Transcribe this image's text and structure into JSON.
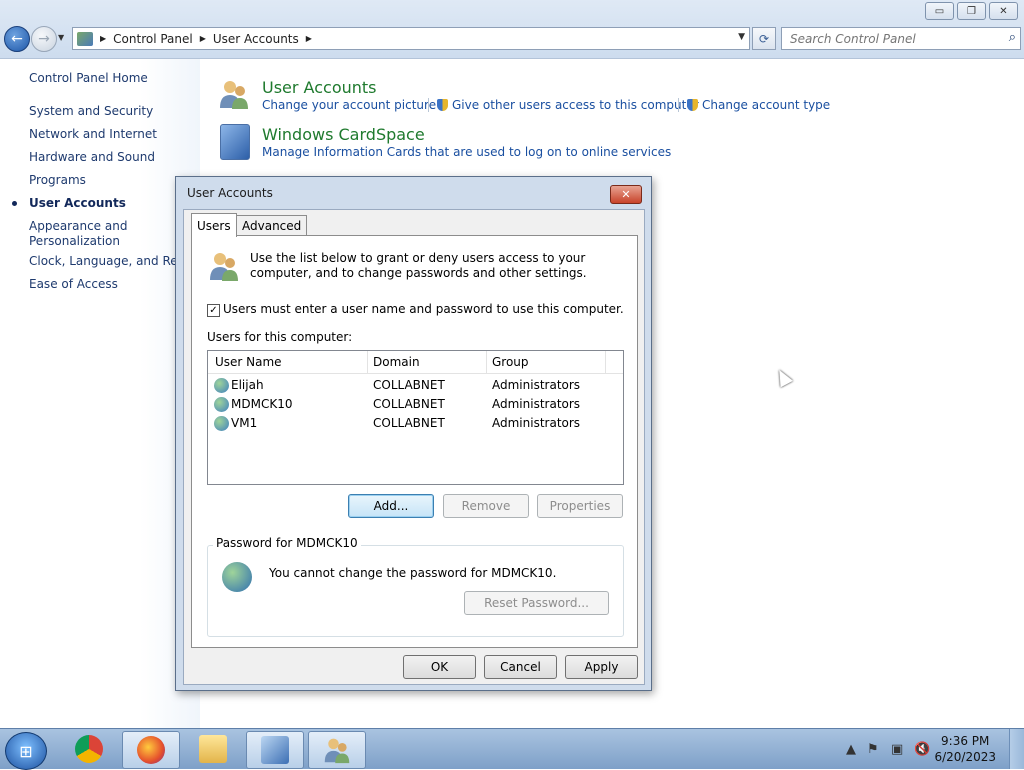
{
  "window": {
    "controls": [
      "▭",
      "❐",
      "✕"
    ]
  },
  "nav": {
    "back_icon": "←",
    "forward_icon": "→",
    "breadcrumbs": [
      "Control Panel",
      "User Accounts"
    ],
    "refresh_icon": "⟳",
    "search_placeholder": "Search Control Panel"
  },
  "sidebar": {
    "home": "Control Panel Home",
    "items": [
      {
        "label": "System and Security"
      },
      {
        "label": "Network and Internet"
      },
      {
        "label": "Hardware and Sound"
      },
      {
        "label": "Programs"
      },
      {
        "label": "User Accounts"
      },
      {
        "label": "Appearance and"
      },
      {
        "label": "Personalization"
      },
      {
        "label": "Clock, Language, and Regio"
      },
      {
        "label": "Ease of Access"
      }
    ]
  },
  "main": {
    "user_accounts": {
      "title": "User Accounts",
      "links": [
        "Change your account picture",
        "Give other users access to this computer",
        "Change account type"
      ]
    },
    "cardspace": {
      "title": "Windows CardSpace",
      "link": "Manage Information Cards that are used to log on to online services"
    }
  },
  "dialog": {
    "title": "User Accounts",
    "close_label": "✕",
    "tabs": [
      "Users",
      "Advanced"
    ],
    "intro": "Use the list below to grant or deny users access to your computer, and to change passwords and other settings.",
    "checkbox_label": "Users must enter a user name and password to use this computer.",
    "checkbox_checked": true,
    "checkbox_mark": "✓",
    "users_label": "Users for this computer:",
    "columns": [
      "User Name",
      "Domain",
      "Group"
    ],
    "rows": [
      {
        "name": "Elijah",
        "domain": "COLLABNET",
        "group": "Administrators"
      },
      {
        "name": "MDMCK10",
        "domain": "COLLABNET",
        "group": "Administrators"
      },
      {
        "name": "VM1",
        "domain": "COLLABNET",
        "group": "Administrators"
      }
    ],
    "buttons": {
      "add": "Add...",
      "remove": "Remove",
      "properties": "Properties"
    },
    "password_group_title": "Password for MDMCK10",
    "password_text": "You cannot change the password for MDMCK10.",
    "reset_button": "Reset Password...",
    "ok": "OK",
    "cancel": "Cancel",
    "apply": "Apply"
  },
  "taskbar": {
    "start_icon": "⊞",
    "time": "9:36 PM",
    "date": "6/20/2023",
    "tray_icons": [
      "▲",
      "⚑",
      "▣",
      "🔇"
    ]
  }
}
